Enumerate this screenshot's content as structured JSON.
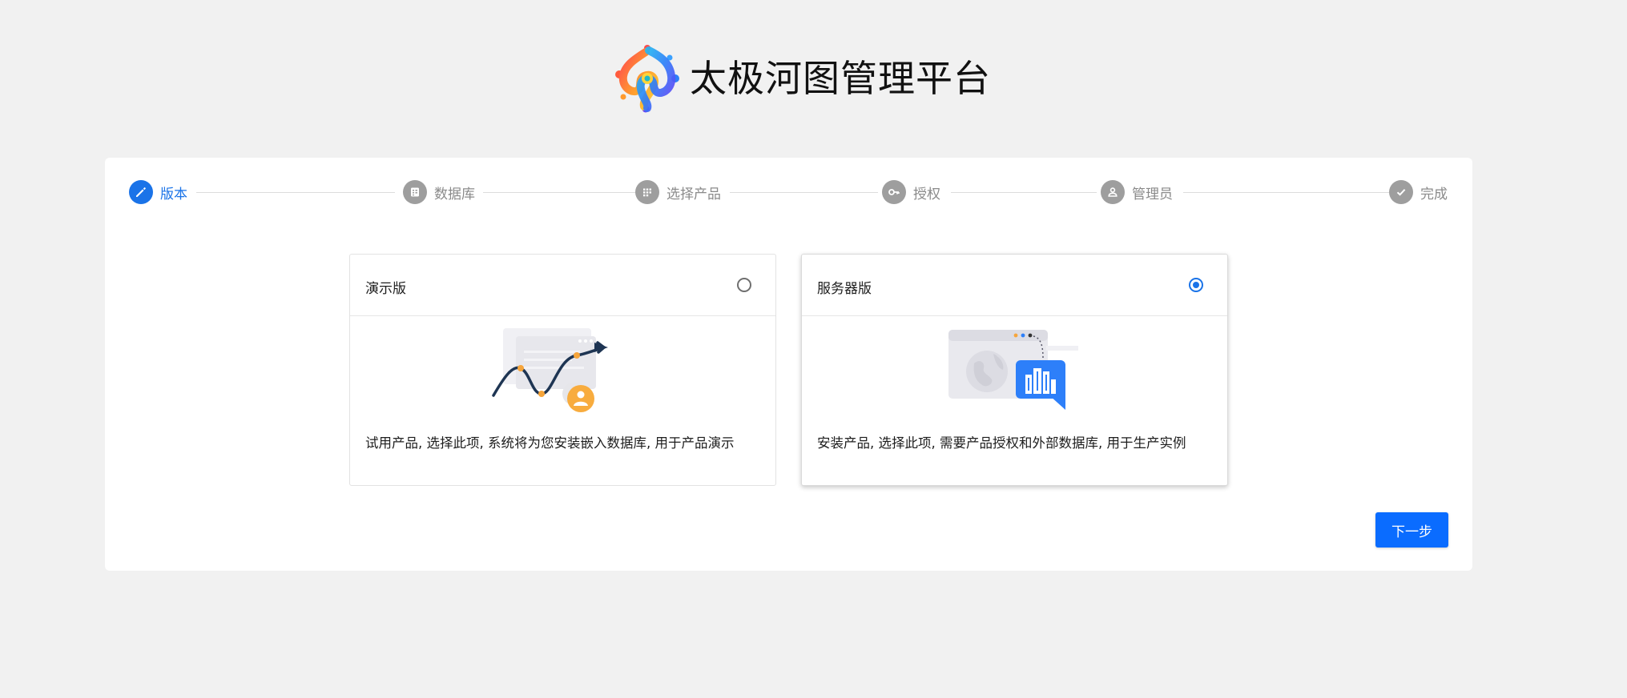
{
  "header": {
    "title": "太极河图管理平台",
    "logo_icon": "taiji-hetu-logo-icon"
  },
  "steps": [
    {
      "label": "版本",
      "icon": "pencil-icon",
      "active": true
    },
    {
      "label": "数据库",
      "icon": "database-icon",
      "active": false
    },
    {
      "label": "选择产品",
      "icon": "grid-icon",
      "active": false
    },
    {
      "label": "授权",
      "icon": "key-icon",
      "active": false
    },
    {
      "label": "管理员",
      "icon": "person-icon",
      "active": false
    },
    {
      "label": "完成",
      "icon": "check-icon",
      "active": false
    }
  ],
  "editions": [
    {
      "title": "演示版",
      "description": "试用产品, 选择此项, 系统将为您安装嵌入数据库, 用于产品演示",
      "selected": false,
      "illustration": "trend-chart-illustration"
    },
    {
      "title": "服务器版",
      "description": "安装产品, 选择此项, 需要产品授权和外部数据库, 用于生产实例",
      "selected": true,
      "illustration": "server-building-illustration"
    }
  ],
  "actions": {
    "next_label": "下一步"
  },
  "colors": {
    "primary": "#1a73e8",
    "button": "#0a6cff",
    "inactive_step": "#9e9e9e",
    "background": "#f1f1f1"
  }
}
